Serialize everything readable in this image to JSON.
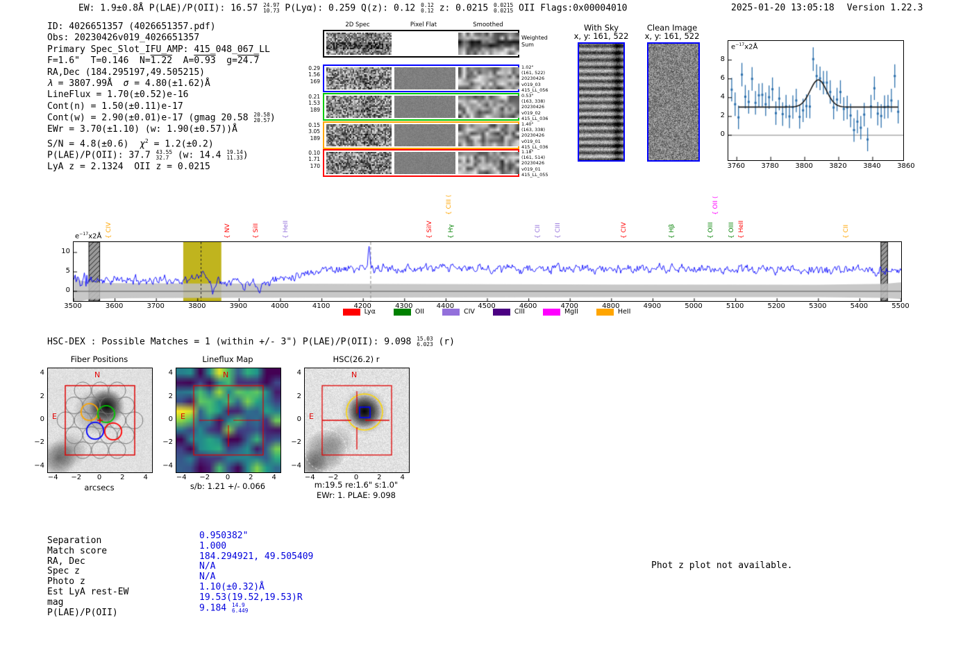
{
  "header": {
    "left_segments": [
      {
        "t": "EW: 1.9±0.8Å  P(LAE)/P(OII): 16.57 "
      },
      {
        "f": [
          "24.97",
          "10.73"
        ]
      },
      {
        "t": "  P(Lyα): 0.259  Q(z): 0.12 "
      },
      {
        "f": [
          "0.12",
          "0.12"
        ]
      },
      {
        "t": "  z: 0.0215 "
      },
      {
        "f": [
          "0.0215",
          "0.0215"
        ]
      },
      {
        "t": " OII  Flags:0x00004010"
      }
    ],
    "datetime": "2025-01-20 13:05:18",
    "version": "Version 1.22.3"
  },
  "info_block": {
    "lines": [
      {
        "segs": [
          {
            "t": "ID: 4026651357 (4026651357.pdf)"
          }
        ]
      },
      {
        "segs": [
          {
            "t": "Obs: 20230426v019_4026651357"
          }
        ]
      },
      {
        "segs": [
          {
            "t": "Primary Spec_Slot_IFU_AMP: 415_048_067_LL"
          }
        ]
      },
      {
        "segs": [
          {
            "t": "F=1.6\"  T=0.146  N="
          },
          {
            "t": "1.22",
            "o": 1
          },
          {
            "t": "  A="
          },
          {
            "t": "0.93",
            "o": 1
          },
          {
            "t": "  g="
          },
          {
            "t": "24.7",
            "o": 1
          }
        ]
      },
      {
        "segs": [
          {
            "t": "RA,Dec (184.295197,49.505215)"
          }
        ]
      },
      {
        "segs": [
          {
            "t": "λ",
            "i": 1
          },
          {
            "t": " = 3807.99Å  "
          },
          {
            "t": "σ",
            "i": 1
          },
          {
            "t": " = 4.80(±1.62)Å"
          }
        ]
      },
      {
        "segs": [
          {
            "t": "LineFlux = 1.70(±0.52)e-16"
          }
        ]
      },
      {
        "segs": [
          {
            "t": "Cont(n) = 1.50(±0.11)e-17"
          }
        ]
      },
      {
        "segs": [
          {
            "t": "Cont(w) = 2.90(±0.01)e-17 (gmag 20.58 "
          },
          {
            "f": [
              "20.58",
              "20.57"
            ]
          },
          {
            "t": ")"
          }
        ]
      },
      {
        "segs": [
          {
            "t": "EWr = 3.70(±1.10) (w: 1.90(±0.57))Å"
          }
        ]
      },
      {
        "segs": [
          {
            "t": "S/N = 4.8(±0.6)  "
          },
          {
            "t": "χ",
            "i": 1
          },
          {
            "sup": "2"
          },
          {
            "t": " = 1.2(±0.2)"
          }
        ]
      },
      {
        "segs": [
          {
            "t": "P(LAE)/P(OII): 37.7 "
          },
          {
            "f": [
              "43.55",
              "32.7"
            ]
          },
          {
            "t": " (w: 14.4 "
          },
          {
            "f": [
              "19.14",
              "11.33"
            ]
          },
          {
            "t": ")"
          }
        ]
      },
      {
        "segs": [
          {
            "t": "LyA z = 2.1324  OII z = 0.0215"
          }
        ]
      }
    ]
  },
  "spec2d": {
    "col_headers": [
      "2D Spec",
      "Pixel Flat",
      "Smoothed"
    ],
    "weighted_label": [
      "Weighted",
      "Sum"
    ],
    "rows": [
      {
        "border_color": "#0000ff",
        "weights": [
          "0.29",
          "1.56",
          "169"
        ],
        "annotation": [
          "1.02\"",
          "(161, 522)",
          "20230426",
          "v019_03",
          "415_LL_056"
        ]
      },
      {
        "border_color": "#00c800",
        "weights": [
          "0.21",
          "1.53",
          "189"
        ],
        "annotation": [
          "0.53\"",
          "(163, 338)",
          "20230426",
          "v019_02",
          "415_LL_036"
        ]
      },
      {
        "border_color": "#ffa500",
        "weights": [
          "0.15",
          "3.05",
          "189"
        ],
        "annotation": [
          "1.40\"",
          "(163, 338)",
          "20230426",
          "v019_01",
          "415_LL_036"
        ]
      },
      {
        "border_color": "#ff0000",
        "weights": [
          "0.10",
          "1.71",
          "170"
        ],
        "annotation": [
          "1.18\"",
          "(161, 514)",
          "20230426",
          "v019_01",
          "415_LL_055"
        ]
      }
    ]
  },
  "sky_panels": [
    {
      "title": "With Sky",
      "coords": "x, y: 161, 522"
    },
    {
      "title": "Clean Image",
      "coords": "x, y: 161, 522"
    }
  ],
  "chart_data": {
    "line_fit_zoom": {
      "type": "scatter",
      "unit_segments": [
        {
          "t": "e"
        },
        {
          "sup": "−17"
        },
        {
          "t": "x2Å"
        }
      ],
      "xlim": [
        3755,
        3858
      ],
      "ylim": [
        -2.66,
        10.0
      ],
      "xticks": [
        "3760",
        "3780",
        "3800",
        "3820",
        "3840",
        "3860"
      ],
      "xtick_values": [
        3760,
        3780,
        3800,
        3820,
        3840,
        3860
      ],
      "yticks": [
        "8",
        "6",
        "4",
        "2",
        "0"
      ],
      "ytick_values": [
        8,
        6,
        4,
        2,
        0
      ],
      "yerr": 1.25,
      "points": [
        [
          3757,
          4.85
        ],
        [
          3759,
          3.3
        ],
        [
          3761,
          1.9
        ],
        [
          3763,
          6.45
        ],
        [
          3765,
          4.1
        ],
        [
          3767,
          3.55
        ],
        [
          3769,
          6.0
        ],
        [
          3771,
          3.45
        ],
        [
          3773,
          4.25
        ],
        [
          3775,
          4.3
        ],
        [
          3777,
          3.3
        ],
        [
          3779,
          4.05
        ],
        [
          3781,
          4.9
        ],
        [
          3783,
          2.35
        ],
        [
          3785,
          3.9
        ],
        [
          3787,
          2.25
        ],
        [
          3789,
          3.05
        ],
        [
          3791,
          2.0
        ],
        [
          3793,
          3.0
        ],
        [
          3795,
          3.7
        ],
        [
          3797,
          1.95
        ],
        [
          3799,
          2.65
        ],
        [
          3801,
          3.1
        ],
        [
          3803,
          3.05
        ],
        [
          3805,
          8.1
        ],
        [
          3807,
          6.3
        ],
        [
          3809,
          6.05
        ],
        [
          3811,
          5.6
        ],
        [
          3813,
          5.6
        ],
        [
          3815,
          4.6
        ],
        [
          3817,
          2.95
        ],
        [
          3819,
          3.8
        ],
        [
          3821,
          4.6
        ],
        [
          3823,
          2.8
        ],
        [
          3825,
          2.95
        ],
        [
          3827,
          2.1
        ],
        [
          3829,
          0.55
        ],
        [
          3831,
          1.45
        ],
        [
          3833,
          0.8
        ],
        [
          3835,
          2.2
        ],
        [
          3837,
          -0.45
        ],
        [
          3839,
          3.05
        ],
        [
          3841,
          5.0
        ],
        [
          3843,
          2.3
        ],
        [
          3845,
          2.05
        ],
        [
          3847,
          3.0
        ],
        [
          3849,
          3.05
        ],
        [
          3851,
          3.7
        ],
        [
          3853,
          6.3
        ],
        [
          3855,
          2.5
        ]
      ],
      "fit": {
        "baseline": 3.0,
        "amplitude": 2.9,
        "center": 3808,
        "sigma": 4.8,
        "x_start": 3761,
        "x_end": 3855
      }
    },
    "main_spectrum": {
      "type": "line",
      "unit_segments": [
        {
          "t": "e"
        },
        {
          "sup": "−17"
        },
        {
          "t": "x2Å"
        }
      ],
      "xlim": [
        3500,
        5500
      ],
      "ylim": [
        -2.5,
        12.7
      ],
      "xticks": [
        "3500",
        "3600",
        "3700",
        "3800",
        "3900",
        "4000",
        "4100",
        "4200",
        "4300",
        "4400",
        "4500",
        "4600",
        "4700",
        "4800",
        "4900",
        "5000",
        "5100",
        "5200",
        "5300",
        "5400",
        "5500"
      ],
      "xtick_values": [
        3500,
        3600,
        3700,
        3800,
        3900,
        4000,
        4100,
        4200,
        4300,
        4400,
        4500,
        4600,
        4700,
        4800,
        4900,
        5000,
        5100,
        5200,
        5300,
        5400,
        5500
      ],
      "yticks": [
        "10",
        "5",
        "0"
      ],
      "ytick_values": [
        10,
        5,
        0
      ],
      "target_line_wavelength": 3808,
      "highlight_band": [
        3765,
        3857
      ],
      "highlight_color": "#c0b41e",
      "sky_dashed_line": 4218,
      "masked_bands": [
        [
          3537,
          3563
        ],
        [
          5451,
          5467
        ]
      ],
      "brace": "{",
      "line_labels": [
        {
          "wavelength": 3606,
          "label": "CIV",
          "color": "#ffa500",
          "row": 0
        },
        {
          "wavelength": 3892,
          "label": "NV",
          "color": "#ff0000",
          "row": 0
        },
        {
          "wavelength": 3962,
          "label": "SiII",
          "color": "#ff0000",
          "row": 0
        },
        {
          "wavelength": 4033,
          "label": "HeII",
          "color": "#9370db",
          "row": 0
        },
        {
          "wavelength": 4381,
          "label": "SiIV",
          "color": "#ff0000",
          "row": 0
        },
        {
          "wavelength": 4428,
          "label": "CIII (",
          "color": "#ffa500",
          "row": 1
        },
        {
          "wavelength": 4433,
          "label": "Hγ",
          "color": "#008000",
          "row": 0
        },
        {
          "wavelength": 4643,
          "label": "CII",
          "color": "#9370db",
          "row": 0
        },
        {
          "wavelength": 4692,
          "label": "CIII",
          "color": "#9370db",
          "row": 0
        },
        {
          "wavelength": 4850,
          "label": "CIV",
          "color": "#ff0000",
          "row": 0
        },
        {
          "wavelength": 4967,
          "label": "Hβ",
          "color": "#008000",
          "row": 0
        },
        {
          "wavelength": 5060,
          "label": "OIII",
          "color": "#008000",
          "row": 0
        },
        {
          "wavelength": 5072,
          "label": "OII (",
          "color": "#ff00ff",
          "row": 1
        },
        {
          "wavelength": 5110,
          "label": "OIII",
          "color": "#008000",
          "row": 0
        },
        {
          "wavelength": 5134,
          "label": "HeII",
          "color": "#ff0000",
          "row": 0
        },
        {
          "wavelength": 5387,
          "label": "CII",
          "color": "#ffa500",
          "row": 0
        }
      ],
      "legend": [
        {
          "label": "Lyα",
          "color": "#ff0000"
        },
        {
          "label": "OII",
          "color": "#008000"
        },
        {
          "label": "CIV",
          "color": "#9370db"
        },
        {
          "label": "CIII",
          "color": "#4b0082"
        },
        {
          "label": "MgII",
          "color": "#ff00ff"
        },
        {
          "label": "HeII",
          "color": "#ffa500"
        }
      ],
      "generator": {
        "seed": 11,
        "step": 2,
        "baseline_nodes": [
          [
            3500,
            2.9
          ],
          [
            3930,
            2.85
          ],
          [
            3948,
            1.1
          ],
          [
            3965,
            2.2
          ],
          [
            4000,
            3.4
          ],
          [
            4110,
            5.75
          ],
          [
            4400,
            5.9
          ],
          [
            4800,
            5.75
          ],
          [
            5200,
            5.6
          ],
          [
            5500,
            5.35
          ]
        ],
        "bump": {
          "x": 3808,
          "amp": 1.6,
          "sigma": 10.5
        },
        "dips": [
          {
            "x": 3838,
            "amp": -2.6,
            "sigma": 4
          },
          {
            "x": 3912,
            "amp": -2.2,
            "sigma": 4.5
          }
        ],
        "spike": {
          "x": 4214,
          "amp": 5.5,
          "sigma": 2.3
        },
        "envelope": [
          [
            3500,
            4.3,
            -4.0
          ],
          [
            3515,
            2.8,
            -2.6
          ],
          [
            3540,
            2.3,
            -2.0
          ],
          [
            3600,
            2.1,
            -1.8
          ],
          [
            3800,
            2.0,
            -1.7
          ],
          [
            4200,
            1.9,
            -1.6
          ],
          [
            4800,
            1.75,
            -1.5
          ],
          [
            5300,
            1.7,
            -1.5
          ],
          [
            5460,
            1.9,
            -1.7
          ],
          [
            5500,
            2.3,
            -2.0
          ]
        ]
      }
    }
  },
  "hsc_line": {
    "segments": [
      {
        "t": "HSC-DEX : Possible Matches = 1 (within +/- 3\")  P(LAE)/P(OII): 9.098 "
      },
      {
        "f": [
          "15.03",
          "6.023"
        ]
      },
      {
        "t": " (r)"
      }
    ]
  },
  "cutouts": {
    "axis_ticks": [
      "−4",
      "−2",
      "0",
      "2",
      "4"
    ],
    "compass": {
      "north": "N",
      "east": "E"
    },
    "fiber": {
      "title": "Fiber Positions",
      "xlabel": "arcsecs"
    },
    "lineflux": {
      "title": "Lineflux Map",
      "caption": "s/b: 1.21 +/- 0.066"
    },
    "hsc": {
      "title": "HSC(26.2) r",
      "caption1": "m:19.5 re:1.6\" s:1.0\"",
      "caption2": "EWr: 1. PLAE: 9.098"
    }
  },
  "match_table": {
    "rows": [
      {
        "label": "Separation",
        "segs": [
          {
            "t": "0.950382\""
          }
        ]
      },
      {
        "label": "Match score",
        "segs": [
          {
            "t": "1.000"
          }
        ]
      },
      {
        "label": "RA, Dec",
        "segs": [
          {
            "t": "184.294921, 49.505409"
          }
        ]
      },
      {
        "label": "Spec z",
        "segs": [
          {
            "t": "N/A"
          }
        ]
      },
      {
        "label": "Photo z",
        "segs": [
          {
            "t": "N/A"
          }
        ]
      },
      {
        "label": "Est LyA rest-EW",
        "segs": [
          {
            "t": "1.10(±0.32)Å"
          }
        ]
      },
      {
        "label": "mag",
        "segs": [
          {
            "t": "19.53(19.52,19.53)R"
          }
        ]
      },
      {
        "label": "P(LAE)/P(OII)",
        "segs": [
          {
            "t": "9.184 "
          },
          {
            "f": [
              "14.9",
              "6.449"
            ]
          }
        ]
      }
    ]
  },
  "photz_note": "Phot z plot not available."
}
